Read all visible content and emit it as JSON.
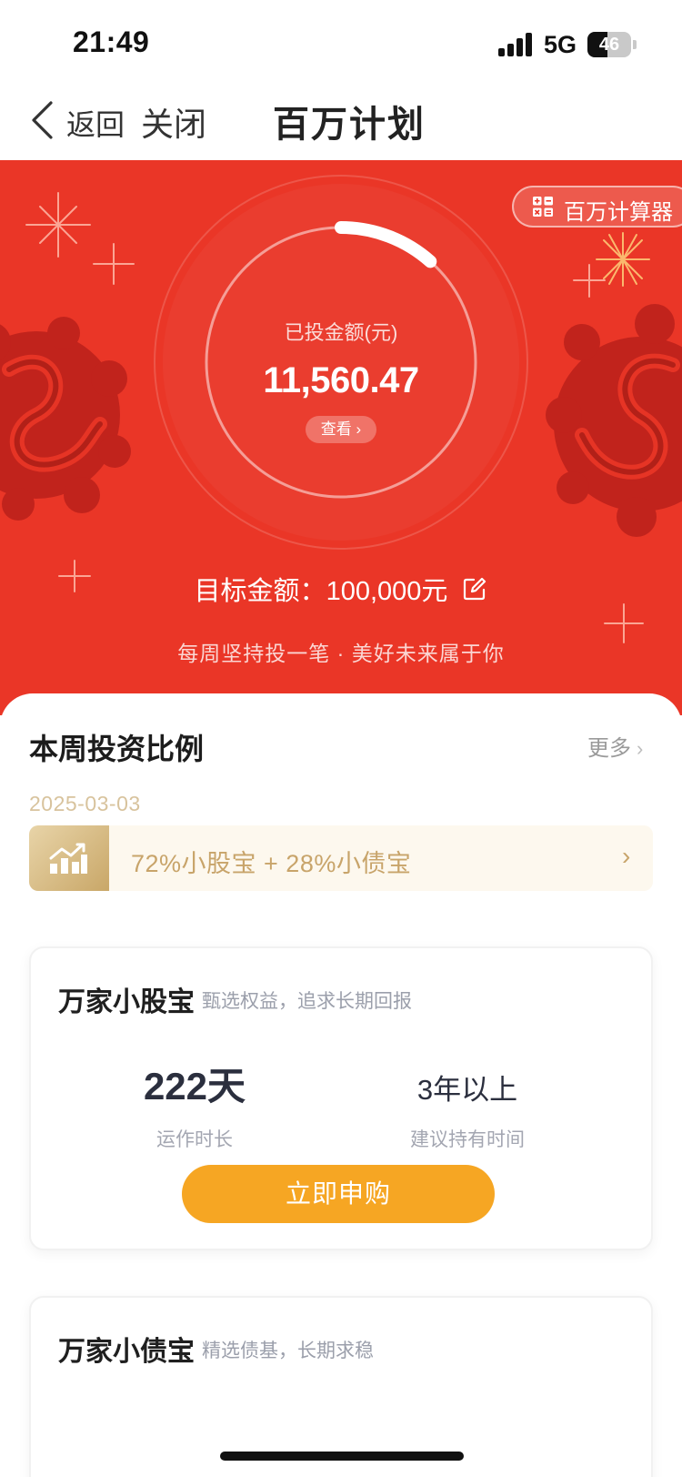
{
  "status_bar": {
    "time": "21:49",
    "network": "5G",
    "battery": "46",
    "battery_level": 0.46
  },
  "nav": {
    "back_label": "返回",
    "close_label": "关闭",
    "title": "百万计划"
  },
  "banner": {
    "calculator_label": "百万计算器",
    "invested_label": "已投金额(元)",
    "invested_amount": "11,560.47",
    "view_label": "查看 ›",
    "target_label": "目标金额：",
    "target_amount": "100,000元",
    "slogan": "每周坚持投一笔 · 美好未来属于你",
    "progress_fraction": 0.1156,
    "color": "#ea3627"
  },
  "weekly": {
    "title": "本周投资比例",
    "more_label": "更多",
    "date": "2025-03-03",
    "ratio_text": "72%小股宝 + 28%小债宝"
  },
  "funds": [
    {
      "name": "万家小股宝",
      "desc": "甄选权益，追求长期回报",
      "stat1_value": "222天",
      "stat1_label": "运作时长",
      "stat2_value": "3年以上",
      "stat2_label": "建议持有时间",
      "button_label": "立即申购"
    },
    {
      "name": "万家小债宝",
      "desc": "精选债基，长期求稳"
    }
  ],
  "colors": {
    "accent": "#f6a623",
    "gold": "#c8a46a",
    "red": "#ea3627"
  }
}
